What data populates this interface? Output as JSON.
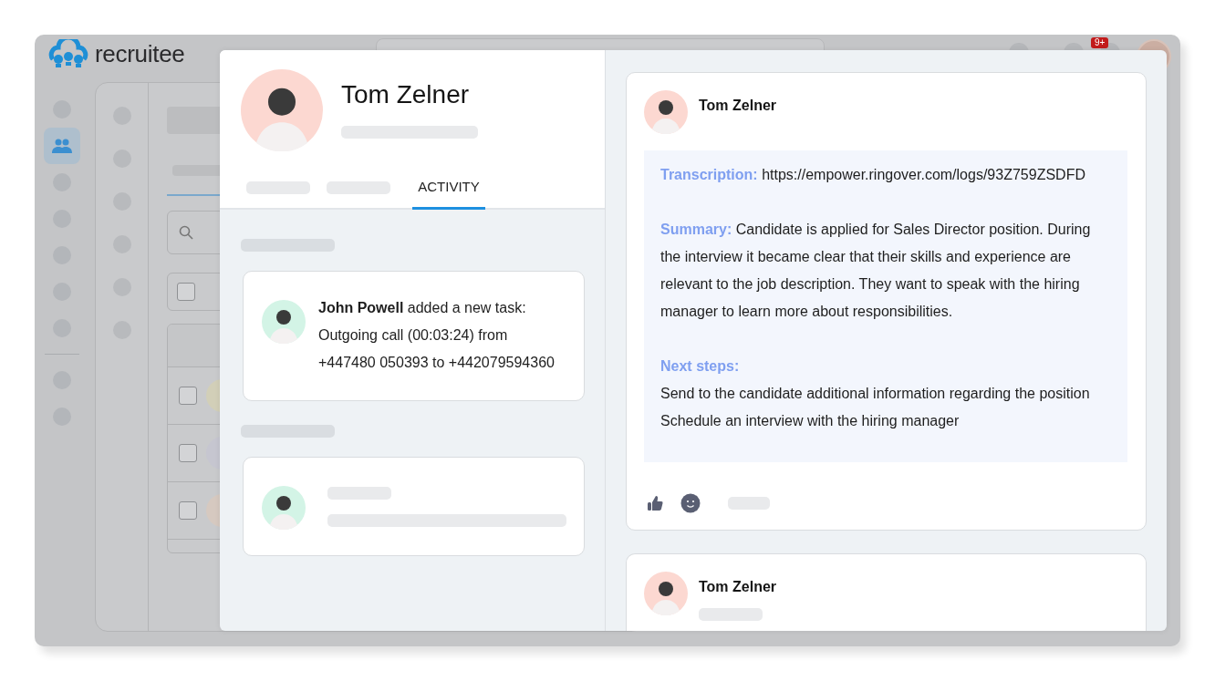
{
  "app": {
    "logo": "recruitee",
    "notification_badge": "9+"
  },
  "background_list": {
    "select_all": {
      "checked": false
    },
    "rows": [
      {
        "checked": false
      },
      {
        "checked": false
      },
      {
        "checked": false
      }
    ]
  },
  "profile": {
    "name": "Tom Zelner",
    "tabs": [
      {
        "kind": "placeholder",
        "selected": false
      },
      {
        "kind": "placeholder",
        "selected": false
      },
      {
        "kind": "label",
        "label": "ACTIVITY",
        "selected": true
      }
    ]
  },
  "activity": [
    {
      "kind": "message",
      "lines": [
        "**John Powell** added a new task:",
        "Outgoing call (00:03:24) from",
        "+447480 050393 to +442079594360"
      ]
    },
    {
      "kind": "placeholder"
    }
  ],
  "notes": [
    {
      "kind": "note",
      "author": "Tom Zelner",
      "sections": [
        {
          "lines": [
            "**Transcription:** https://empower.ringover.com/logs/93Z759ZSDFD"
          ]
        },
        {
          "lines": [
            "**Summary:** Candidate is applied for Sales Director position. During the interview it became clear that their skills and experience are relevant to the job description. They want to speak with the hiring manager to learn more about responsibilities."
          ]
        },
        {
          "lines": [
            "**Next steps:**",
            "Send to the candidate additional information regarding the position",
            "Schedule an interview with the hiring manager"
          ]
        }
      ]
    },
    {
      "kind": "placeholder",
      "author": "Tom Zelner"
    }
  ]
}
